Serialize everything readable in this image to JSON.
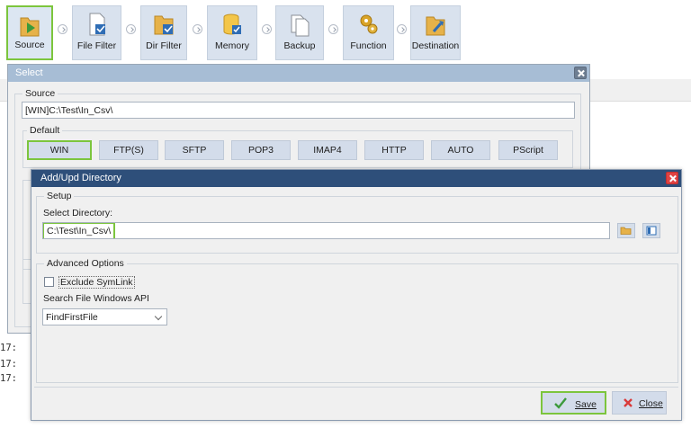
{
  "toolbar": {
    "items": [
      {
        "label": "Source",
        "icon": "source-icon",
        "active": true
      },
      {
        "label": "File Filter",
        "icon": "file-filter-icon"
      },
      {
        "label": "Dir Filter",
        "icon": "dir-filter-icon"
      },
      {
        "label": "Memory",
        "icon": "memory-icon"
      },
      {
        "label": "Backup",
        "icon": "backup-icon"
      },
      {
        "label": "Function",
        "icon": "function-icon"
      },
      {
        "label": "Destination",
        "icon": "destination-icon"
      }
    ]
  },
  "log": {
    "lines": [
      "17:",
      "17:",
      "17:"
    ]
  },
  "select_window": {
    "title": "Select",
    "source_group": "Source",
    "source_value": "[WIN]C:\\Test\\In_Csv\\",
    "default_group": "Default",
    "protocols": [
      "WIN",
      "FTP(S)",
      "SFTP",
      "POP3",
      "IMAP4",
      "HTTP",
      "AUTO",
      "PScript"
    ],
    "active_protocol": "WIN"
  },
  "dialog": {
    "title": "Add/Upd Directory",
    "setup_group": "Setup",
    "select_dir_label": "Select Directory:",
    "dir_value": "C:\\Test\\In_Csv\\",
    "advanced_group": "Advanced  Options",
    "exclude_symlink_label": "Exclude SymLink",
    "exclude_symlink_checked": false,
    "search_api_label": "Search File Windows API",
    "search_api_value": "FindFirstFile",
    "save_label": "Save",
    "close_label": "Close"
  },
  "colors": {
    "accent_green": "#7cc53d",
    "dialog_title": "#2e4f7a",
    "close_red": "#e04343"
  }
}
